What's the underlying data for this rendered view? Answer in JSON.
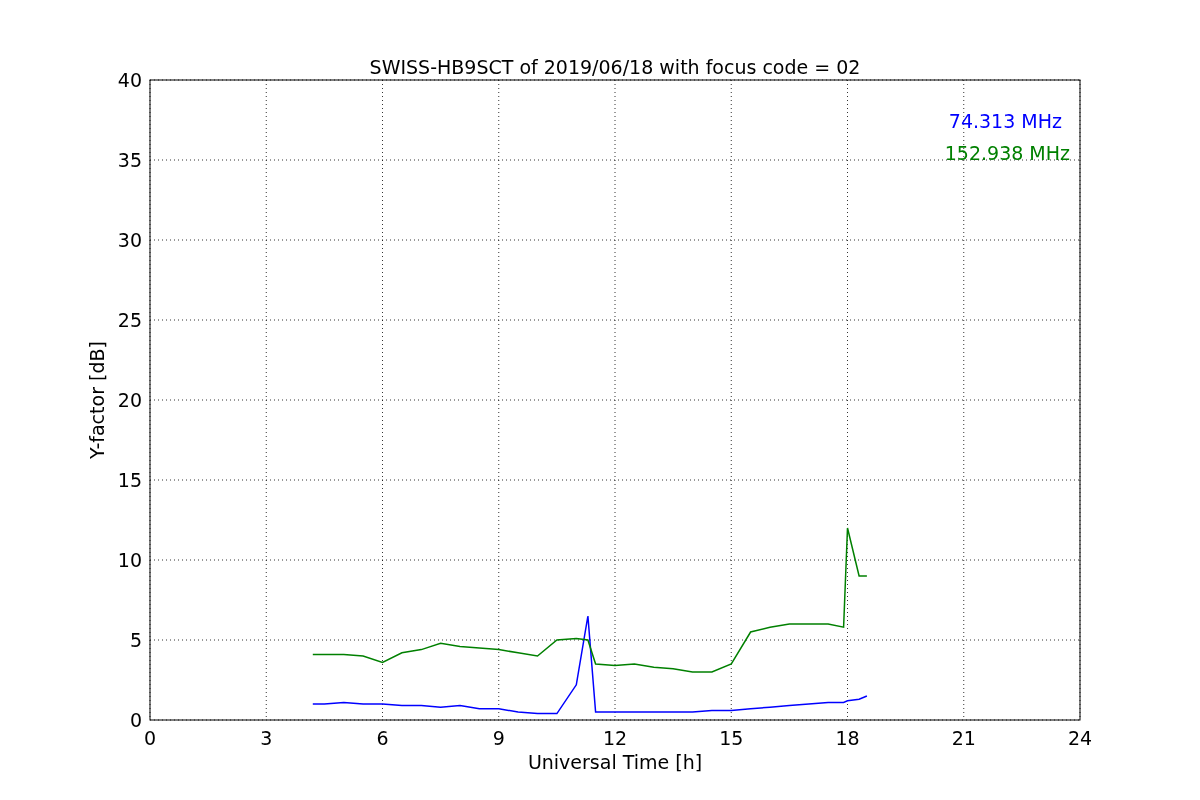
{
  "figure": {
    "chart_data": {
      "type": "line",
      "title": "SWISS-HB9SCT of 2019/06/18 with focus code = 02",
      "xlabel": "Universal Time [h]",
      "ylabel": "Y-factor [dB]",
      "x": [
        4.2,
        4.5,
        5,
        5.5,
        6,
        6.5,
        7,
        7.5,
        8,
        8.5,
        9,
        9.5,
        10,
        10.5,
        11,
        11.3,
        11.5,
        12,
        12.5,
        13,
        13.5,
        14,
        14.5,
        15,
        15.5,
        16,
        16.5,
        17,
        17.5,
        17.9,
        18,
        18.3,
        18.5
      ],
      "series": [
        {
          "name": "74.313 MHz",
          "color": "#0000ff",
          "values": [
            1.0,
            1.0,
            1.1,
            1.0,
            1.0,
            0.9,
            0.9,
            0.8,
            0.9,
            0.7,
            0.7,
            0.5,
            0.4,
            0.4,
            2.2,
            6.5,
            0.5,
            0.5,
            0.5,
            0.5,
            0.5,
            0.5,
            0.6,
            0.6,
            0.7,
            0.8,
            0.9,
            1.0,
            1.1,
            1.1,
            1.2,
            1.3,
            1.5
          ]
        },
        {
          "name": "152.938 MHz",
          "color": "#008000",
          "values": [
            4.1,
            4.1,
            4.1,
            4.0,
            3.6,
            4.2,
            4.4,
            4.8,
            4.6,
            4.5,
            4.4,
            4.2,
            4.0,
            5.0,
            5.1,
            5.0,
            3.5,
            3.4,
            3.5,
            3.3,
            3.2,
            3.0,
            3.0,
            3.5,
            5.5,
            5.8,
            6.0,
            6.0,
            6.0,
            5.8,
            12.0,
            9.0,
            9.0
          ]
        }
      ],
      "grid": true,
      "xlim": [
        0,
        24
      ],
      "ylim": [
        0,
        40
      ],
      "xticks": [
        0,
        3,
        6,
        9,
        12,
        15,
        18,
        21,
        24
      ],
      "yticks": [
        0,
        5,
        10,
        15,
        20,
        25,
        30,
        35,
        40
      ]
    }
  }
}
